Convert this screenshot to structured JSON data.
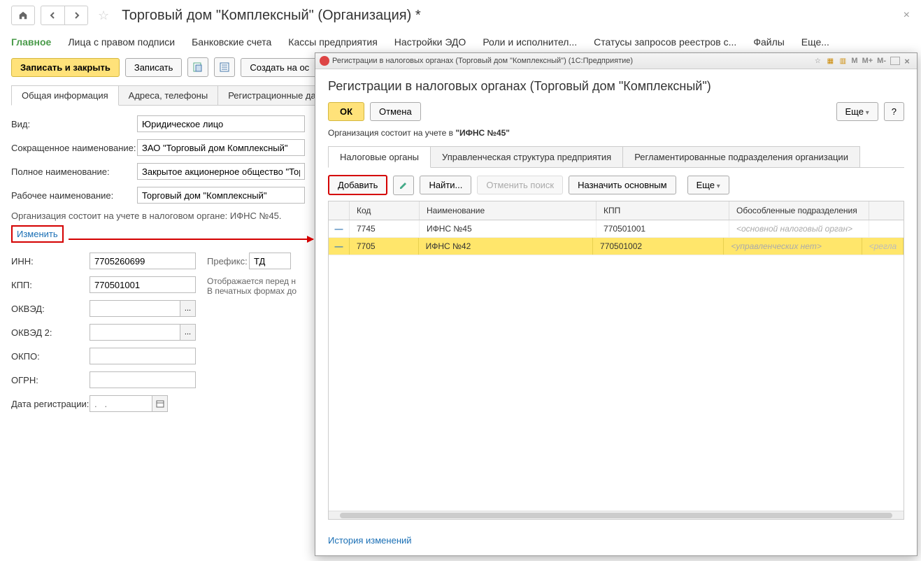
{
  "main": {
    "title": "Торговый дом \"Комплексный\" (Организация) *",
    "sections": [
      "Главное",
      "Лица с правом подписи",
      "Банковские счета",
      "Кассы предприятия",
      "Настройки ЭДО",
      "Роли и исполнител...",
      "Статусы запросов реестров с...",
      "Файлы",
      "Еще..."
    ],
    "toolbar": {
      "save_close": "Записать и закрыть",
      "save": "Записать",
      "create_based": "Создать на ос"
    },
    "inner_tabs": [
      "Общая информация",
      "Адреса, телефоны",
      "Регистрационные данн"
    ],
    "fields": {
      "kind_label": "Вид:",
      "kind_value": "Юридическое лицо",
      "short_name_label": "Сокращенное наименование:",
      "short_name_value": "ЗАО \"Торговый дом Комплексный\"",
      "full_name_label": "Полное наименование:",
      "full_name_value": "Закрытое акционерное общество \"Торг",
      "work_name_label": "Рабочее наименование:",
      "work_name_value": "Торговый дом \"Комплексный\"",
      "note": "Организация состоит на учете в налоговом органе: ИФНС №45.",
      "change_link": "Изменить",
      "inn_label": "ИНН:",
      "inn_value": "7705260699",
      "kpp_label": "КПП:",
      "kpp_value": "770501001",
      "okved_label": "ОКВЭД:",
      "okved2_label": "ОКВЭД 2:",
      "okpo_label": "ОКПО:",
      "ogrn_label": "ОГРН:",
      "reg_date_label": "Дата регистрации:",
      "reg_date_placeholder": ".   .",
      "prefix_label": "Префикс:",
      "prefix_value": "ТД",
      "prefix_note1": "Отображается перед н",
      "prefix_note2": "В печатных формах до"
    }
  },
  "modal": {
    "window_title": "Регистрации в налоговых органах (Торговый дом \"Комплексный\")  (1С:Предприятие)",
    "title": "Регистрации в налоговых органах (Торговый дом \"Комплексный\")",
    "ok": "ОК",
    "cancel": "Отмена",
    "more": "Еще",
    "help": "?",
    "status_prefix": "Организация состоит на учете в ",
    "status_bold": "\"ИФНС №45\"",
    "tabs": [
      "Налоговые органы",
      "Управленческая структура предприятия",
      "Регламентированные подразделения организации"
    ],
    "grid_toolbar": {
      "add": "Добавить",
      "find": "Найти...",
      "cancel_search": "Отменить поиск",
      "set_main": "Назначить основным",
      "more": "Еще"
    },
    "grid": {
      "columns": [
        "Код",
        "Наименование",
        "КПП",
        "Обособленные подразделения"
      ],
      "rows": [
        {
          "code": "7745",
          "name": "ИФНС №45",
          "kpp": "770501001",
          "dept": "<основной налоговый орган>",
          "selected": false
        },
        {
          "code": "7705",
          "name": "ИФНС №42",
          "kpp": "770501002",
          "dept": "<управленческих нет>",
          "extra": "<регла",
          "selected": true
        }
      ]
    },
    "history": "История изменений",
    "m_badges": [
      "M",
      "M+",
      "M-"
    ]
  }
}
